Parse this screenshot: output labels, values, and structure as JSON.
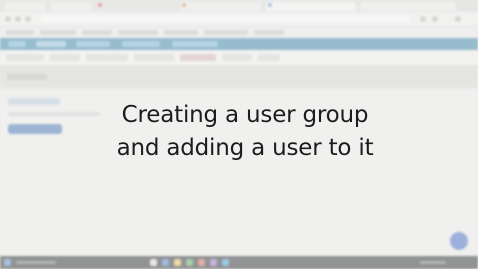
{
  "overlay": {
    "title_line1": "Creating a user group",
    "title_line2": "and adding a user to it"
  },
  "colors": {
    "nav_bar": "#2a7fa8",
    "primary_button": "#3b6fb6",
    "fab": "#3a64c6",
    "taskbar": "#1f2428"
  },
  "icons": [
    "chat-icon"
  ]
}
